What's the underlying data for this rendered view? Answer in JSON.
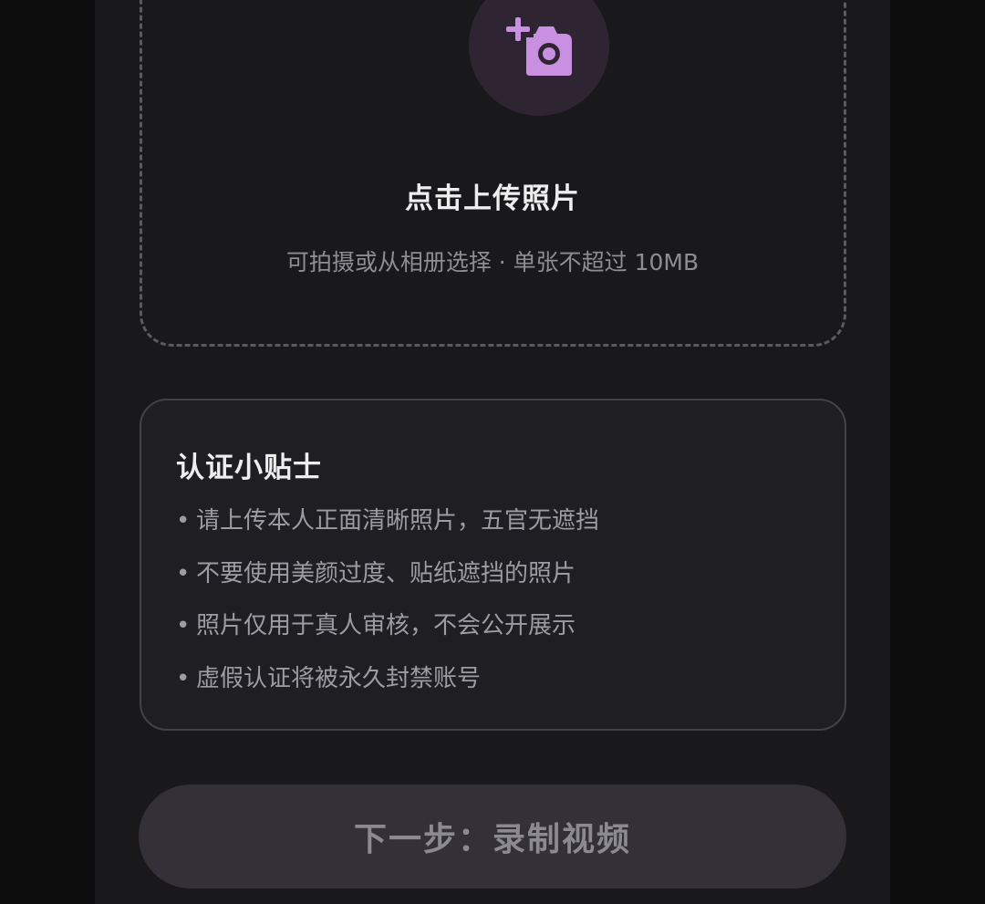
{
  "upload": {
    "title": "点击上传照片",
    "hint": "可拍摄或从相册选择 · 单张不超过 10MB",
    "icon": "add-photo-icon",
    "icon_color": "#c98fe0",
    "circle_color": "#2f2532"
  },
  "tips": {
    "title": "认证小贴士",
    "bullet": "•",
    "items": [
      "请上传本人正面清晰照片，五官无遮挡",
      "不要使用美颜过度、贴纸遮挡的照片",
      "照片仅用于真人审核，不会公开展示",
      "虚假认证将被永久封禁账号"
    ]
  },
  "next_button": {
    "label": "下一步：录制视频"
  }
}
